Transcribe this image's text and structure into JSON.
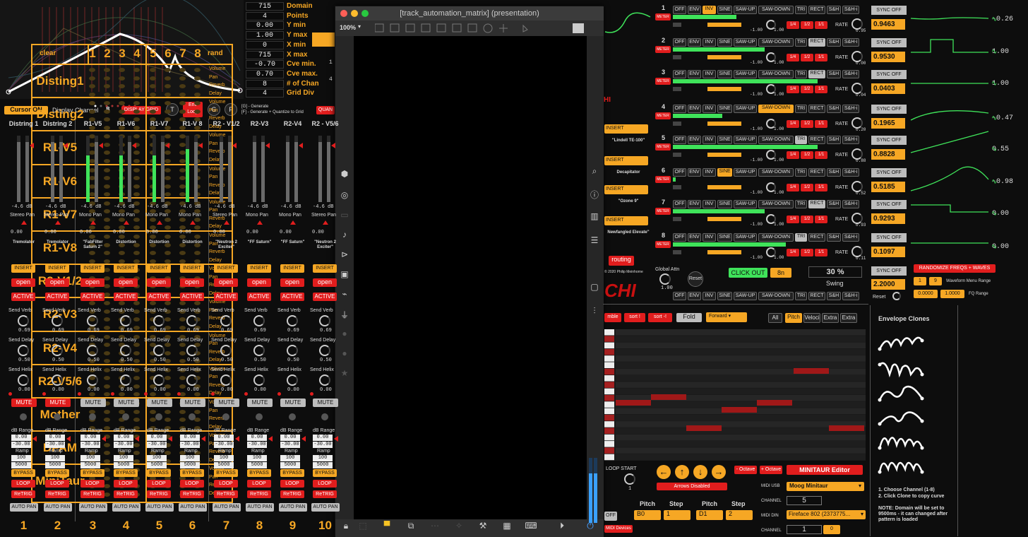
{
  "editor": {
    "params": [
      {
        "value": "715",
        "label": "Domain"
      },
      {
        "value": "4",
        "label": "Points"
      },
      {
        "value": "0.00",
        "label": "Y min"
      },
      {
        "value": "1.00",
        "label": "Y max"
      },
      {
        "value": "0",
        "label": "X min"
      },
      {
        "value": "715",
        "label": "X max"
      },
      {
        "value": "-0.70",
        "label": "Cve min."
      },
      {
        "value": "0.70",
        "label": "Cve max."
      },
      {
        "value": "8",
        "label": "# of Chan"
      },
      {
        "value": "4",
        "label": "Grid Div"
      }
    ],
    "cursor_btn": "Cursor ON",
    "display_channel_label": "Display Channel",
    "display_channel_value": "8",
    "display_grid": "DISPLAY GRID",
    "t_btn": "T",
    "env_loop": "Env Loop",
    "g_btn": "G",
    "f_btn": "F",
    "hint1": "[G] - Generate",
    "hint2": "[F] - Generate + Quantize to Grid",
    "quan": "QUAN",
    "side_vals": [
      "1",
      "4"
    ]
  },
  "mixer": {
    "strips": [
      {
        "name": "Distring 1",
        "db": "-4.6 dB",
        "pan": "Stereo Pan",
        "plugin": "Tremolator",
        "verb": "0.69",
        "delay": "0.50",
        "helix": "0.00",
        "mute_red": true,
        "num": "1",
        "meter": [
          0,
          0
        ],
        "ramp": "100",
        "rmax": "5000",
        "loop_red": true
      },
      {
        "name": "Distring 2",
        "db": "-4.6 dB",
        "pan": "Stereo Pan",
        "plugin": "Tremolator",
        "verb": "0.69",
        "delay": "0.50",
        "helix": "0.00",
        "mute_red": true,
        "num": "2",
        "meter": [
          0,
          0
        ],
        "ramp": "100",
        "rmax": "5000",
        "loop_red": true
      },
      {
        "name": "R1-V5",
        "db": "-4.6 dB",
        "pan": "Mono Pan",
        "plugin": "\"FabFilter Saturn 2\"",
        "verb": "0.69",
        "delay": "0.50",
        "helix": "0.00",
        "mute_red": false,
        "num": "3",
        "meter": [
          70,
          0
        ],
        "ramp": "100",
        "rmax": "5000",
        "loop_red": true
      },
      {
        "name": "R1-V6",
        "db": "-4.6 dB",
        "pan": "Mono Pan",
        "plugin": "Distortion",
        "verb": "0.69",
        "delay": "0.50",
        "helix": "0.00",
        "mute_red": false,
        "num": "4",
        "meter": [
          70,
          0
        ],
        "ramp": "100",
        "rmax": "5000",
        "loop_red": true
      },
      {
        "name": "R1-V7",
        "db": "-4.6 dB",
        "pan": "Mono Pan",
        "plugin": "Distortion",
        "verb": "0.69",
        "delay": "0.50",
        "helix": "0.00",
        "mute_red": false,
        "num": "5",
        "meter": [
          70,
          0
        ],
        "ramp": "100",
        "rmax": "5000",
        "loop_red": true
      },
      {
        "name": "R1-V 8",
        "db": "-4.6 dB",
        "pan": "Mono Pan",
        "plugin": "Distortion",
        "verb": "0.69",
        "delay": "0.50",
        "helix": "0.00",
        "mute_red": false,
        "num": "6",
        "meter": [
          80,
          0
        ],
        "ramp": "100",
        "rmax": "5000",
        "loop_red": true
      },
      {
        "name": "R2 - V1/2",
        "db": "-4.6 dB",
        "pan": "Stereo Pan",
        "plugin": "\"Neutron 2 Exciter\"",
        "verb": "0.69",
        "delay": "0.50",
        "helix": "0.00",
        "mute_red": false,
        "num": "7",
        "meter": [
          0,
          0
        ],
        "ramp": "100",
        "rmax": "5000",
        "loop_red": true
      },
      {
        "name": "R2-V3",
        "db": "-4.6 dB",
        "pan": "Mono Pan",
        "plugin": "\"FF Saturn\"",
        "verb": "0.69",
        "delay": "0.50",
        "helix": "0.00",
        "mute_red": false,
        "num": "8",
        "meter": [
          0,
          0
        ],
        "ramp": "100",
        "rmax": "5000",
        "loop_red": true
      },
      {
        "name": "R2-V4",
        "db": "-4.6 dB",
        "pan": "Mono Pan",
        "plugin": "\"FF Saturn\"",
        "verb": "0.69",
        "delay": "0.50",
        "helix": "0.00",
        "mute_red": false,
        "num": "9",
        "meter": [
          0,
          0
        ],
        "ramp": "100",
        "rmax": "5000",
        "loop_red": true
      },
      {
        "name": "R2 - V5/6",
        "db": "-4.6 dB",
        "pan": "Stereo Pan",
        "plugin": "\"Neutron 2 Exciter\"",
        "verb": "0.69",
        "delay": "0.50",
        "helix": "0.00",
        "mute_red": false,
        "num": "10",
        "meter": [
          0,
          0
        ],
        "ramp": "100",
        "rmax": "5000",
        "loop_red": true
      }
    ],
    "labels": {
      "insert": "INSERT",
      "open": "open",
      "active": "ACTIVE",
      "send_verb": "Send Verb",
      "send_delay": "Send Delay",
      "send_helix": "Send Helix",
      "mute": "MUTE",
      "db_range": "dB Range",
      "db_max": "0.00",
      "db_min": "-30.00",
      "ramp": "Ramp",
      "bypass": "BYPASS",
      "loop": "LOOP",
      "retrig": "ReTRIG",
      "auto_pan": "AUTO PAN"
    }
  },
  "window": {
    "title": "[track_automation_matrix] (presentation)",
    "zoom": "100%",
    "matrix": {
      "clear": "clear",
      "cols": [
        "1",
        "2",
        "3",
        "4",
        "5",
        "6",
        "7",
        "8"
      ],
      "rand": "rand",
      "params": [
        "Volume",
        "Pan",
        "Reverb",
        "Delay"
      ],
      "rows": [
        "Disting1",
        "Disting2",
        "R1-V5",
        "R1-V6",
        "R1-V7",
        "R1-V8",
        "R2-V1/2",
        "R2-V3",
        "R2-V4",
        "R2-V5/6",
        "Mother",
        "DFAM",
        "MiniTaur"
      ]
    }
  },
  "middle": {
    "inserts": [
      {
        "btn": "INSERT",
        "name": "\"Lindell TE-100\""
      },
      {
        "btn": "INSERT",
        "name": "Decapitator"
      },
      {
        "btn": "INSERT",
        "name": "\"Ozone 9\""
      },
      {
        "btn": "INSERT",
        "name": "Newfangled Elevate\""
      }
    ],
    "routing": "routing",
    "copyright": "© 2020 Philip Meinhorne",
    "brand": "CHI",
    "off": "OFF",
    "devices": "MIDI Devices"
  },
  "lfos": [
    {
      "n": "1",
      "val": "0.9463",
      "rv": "-0.26",
      "rate": "0.95",
      "active": "INV"
    },
    {
      "n": "2",
      "val": "0.9530",
      "rv": "1.00",
      "rate": "0.00",
      "active": "RECT"
    },
    {
      "n": "3",
      "val": "0.0403",
      "rv": "1.00",
      "rate": "0.04",
      "active": "RECT"
    },
    {
      "n": "4",
      "val": "0.1965",
      "rv": "-0.47",
      "rate": "0.20",
      "active": "SAW-DOWN"
    },
    {
      "n": "5",
      "val": "0.8828",
      "rv": "0.55",
      "rate": "0.88",
      "active": "TRI"
    },
    {
      "n": "6",
      "val": "0.5185",
      "rv": "-0.98",
      "rate": "0.52",
      "active": "SINE"
    },
    {
      "n": "7",
      "val": "0.9293",
      "rv": "0.00",
      "rate": "0.93",
      "active": "RECT"
    },
    {
      "n": "8",
      "val": "0.1097",
      "rv": "0.00",
      "rate": "0.11",
      "active": "TRI"
    }
  ],
  "lfo_labels": {
    "meter": "METER",
    "waves": [
      "OFF",
      "ENV",
      "INV",
      "SINE",
      "SAW-UP",
      "SAW-DOWN",
      "TRI",
      "RECT",
      "S&H",
      "S&H-i"
    ],
    "rate": "RATE",
    "sync": "SYNC OFF",
    "min": "-1.00",
    "max": "1.00",
    "mults": [
      "1/4",
      "1/2",
      "1/1"
    ]
  },
  "global": {
    "attn_label": "Global Attn",
    "attn": "1.00",
    "reset": "Reset",
    "click_out": "CLICK OUT",
    "click_val": "8n",
    "swing_val": "30 %",
    "swing": "Swing",
    "sync": "SYNC OFF",
    "val": "2.2000",
    "reset2": "Reset",
    "randomize": "RANDOMIZE FREQS + WAVES",
    "wf_label": "Waveform Menu Range",
    "wf_a": "1",
    "wf_b": "9",
    "fq_a": "0.0000",
    "fq_b": "1.0000",
    "fq_label": "FQ Range"
  },
  "seq": {
    "ramble": "mble",
    "sort1": "sort !",
    "sort2": "sort -!",
    "fold": "Fold",
    "dir": "Forward",
    "tabs": [
      "All",
      "Pitch",
      "Veloci",
      "Extra",
      "Extra"
    ],
    "loop_start": "LOOP START",
    "loop_val": "1",
    "arrows": "Arrows Disabled",
    "oct_down": "- Octave",
    "oct_up": "+ Octave",
    "editor": "MINITAUR Editor",
    "midi_usb": "MIDI USB",
    "midi_dev": "Moog Minitaur",
    "channel": "CHANNEL",
    "ch1": "5",
    "midi_din": "MIDI DIN",
    "din_dev": "Fireface 802 (2373775...",
    "ch2": "1",
    "ch2b": "0",
    "pitch1": "Pitch",
    "step1": "Step",
    "pitch2": "Pitch",
    "step2": "Step",
    "p1": "B0",
    "s1": "1",
    "p2": "D1",
    "s2": "2"
  },
  "clones": {
    "title": "Envelope Clones",
    "note1": "1. Choose Channel (1-8)",
    "note2": "2. Click Clone to copy curve",
    "note3": "NOTE: Domain will be set to 9500ms - it can changed after pattern is loaded"
  }
}
